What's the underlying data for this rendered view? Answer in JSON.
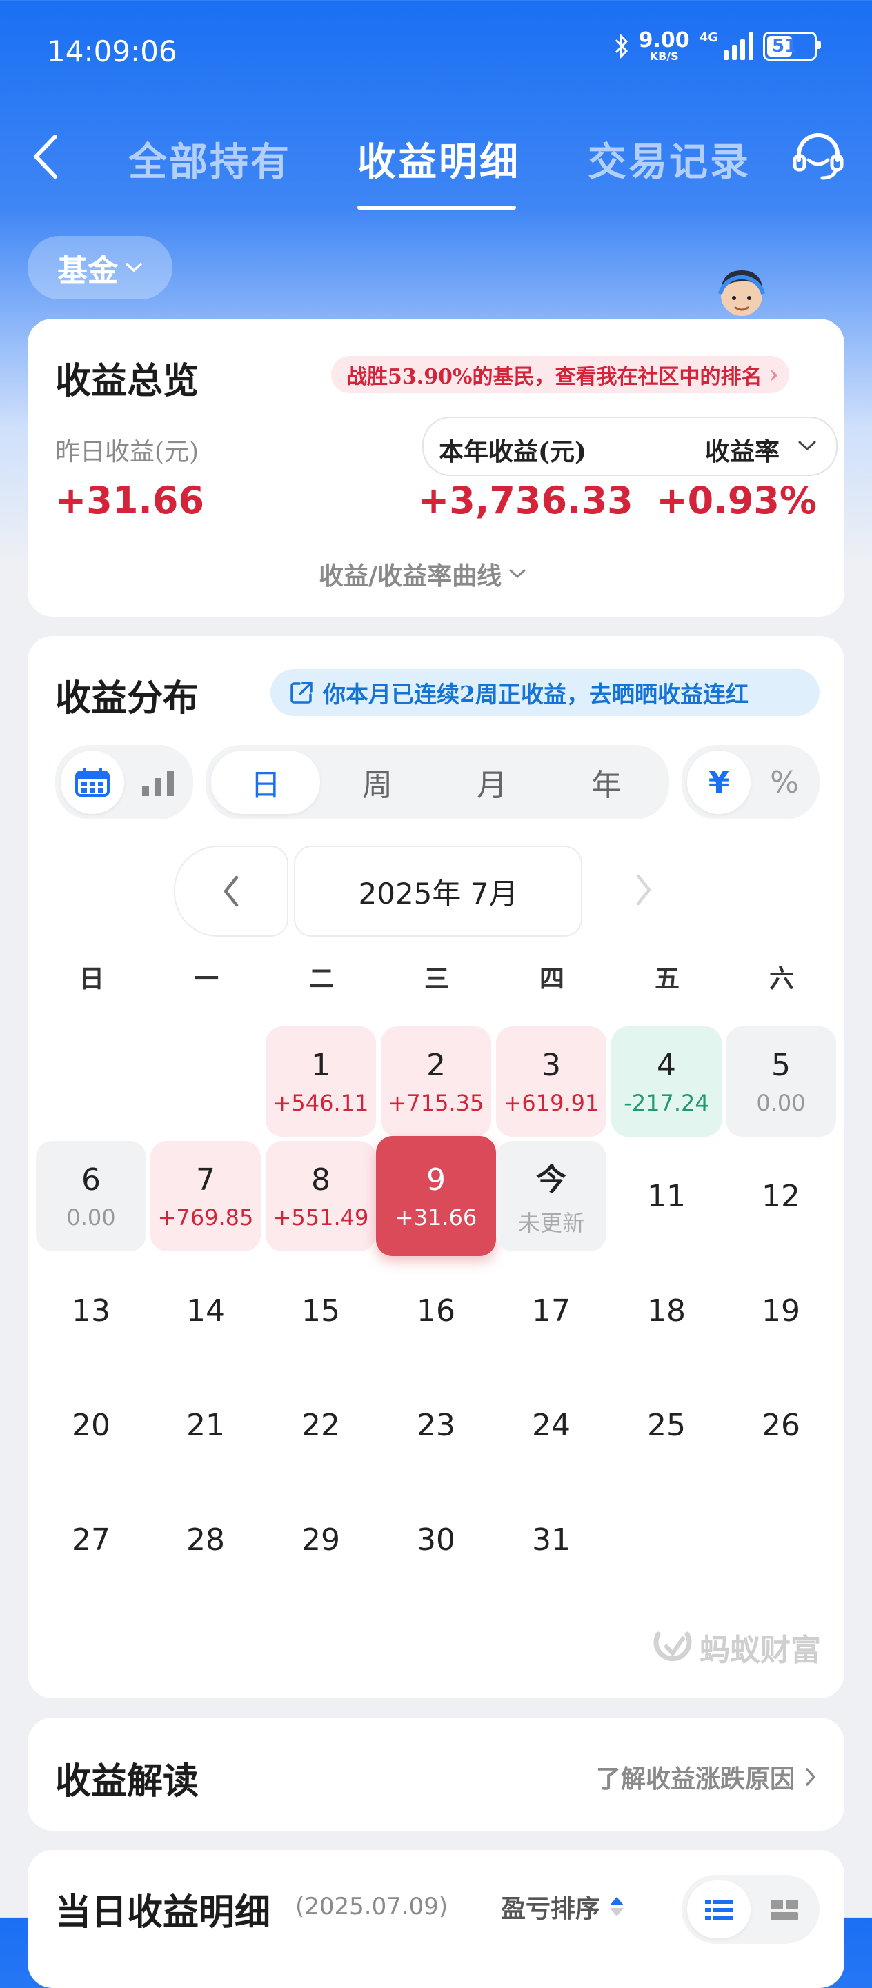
{
  "status_bar": {
    "time": "14:09:06",
    "net_speed": "9.00",
    "net_unit": "KB/S",
    "network_gen": "4G",
    "battery": "51"
  },
  "header": {
    "tabs": [
      {
        "label": "全部持有",
        "active": false
      },
      {
        "label": "收益明细",
        "active": true
      },
      {
        "label": "交易记录",
        "active": false
      }
    ],
    "icons": [
      "chevron-left-icon",
      "headset-icon"
    ]
  },
  "fund_selector": {
    "label": "基金"
  },
  "overview": {
    "title": "收益总览",
    "rank_badge": "战胜53.90%的基民，查看我在社区中的排名",
    "yesterday_label": "昨日收益(元)",
    "yesterday_value": "+31.66",
    "year_label": "本年收益(元)",
    "year_value": "+3,736.33",
    "rate_label": "收益率",
    "rate_value": "+0.93%",
    "curve_link": "收益/收益率曲线"
  },
  "distribution": {
    "title": "收益分布",
    "info_pill": "你本月已连续2周正收益，去晒晒收益连红",
    "period_tabs": [
      "日",
      "周",
      "月",
      "年"
    ],
    "active_period": "日",
    "unit_toggle": [
      "¥",
      "%"
    ],
    "active_unit": "¥",
    "month_label": "2025年 7月",
    "weekdays": [
      "日",
      "一",
      "二",
      "三",
      "四",
      "五",
      "六"
    ],
    "days": [
      {
        "day": "1",
        "value": "+546.11",
        "kind": "pos"
      },
      {
        "day": "2",
        "value": "+715.35",
        "kind": "pos"
      },
      {
        "day": "3",
        "value": "+619.91",
        "kind": "pos"
      },
      {
        "day": "4",
        "value": "-217.24",
        "kind": "neg"
      },
      {
        "day": "5",
        "value": "0.00",
        "kind": "zero"
      },
      {
        "day": "6",
        "value": "0.00",
        "kind": "zero"
      },
      {
        "day": "7",
        "value": "+769.85",
        "kind": "pos"
      },
      {
        "day": "8",
        "value": "+551.49",
        "kind": "pos"
      },
      {
        "day": "9",
        "value": "+31.66",
        "kind": "sel"
      },
      {
        "day": "今",
        "value": "未更新",
        "kind": "today"
      },
      {
        "day": "11",
        "value": "",
        "kind": "plain"
      },
      {
        "day": "12",
        "value": "",
        "kind": "plain"
      },
      {
        "day": "13",
        "value": "",
        "kind": "plain"
      },
      {
        "day": "14",
        "value": "",
        "kind": "plain"
      },
      {
        "day": "15",
        "value": "",
        "kind": "plain"
      },
      {
        "day": "16",
        "value": "",
        "kind": "plain"
      },
      {
        "day": "17",
        "value": "",
        "kind": "plain"
      },
      {
        "day": "18",
        "value": "",
        "kind": "plain"
      },
      {
        "day": "19",
        "value": "",
        "kind": "plain"
      },
      {
        "day": "20",
        "value": "",
        "kind": "plain"
      },
      {
        "day": "21",
        "value": "",
        "kind": "plain"
      },
      {
        "day": "22",
        "value": "",
        "kind": "plain"
      },
      {
        "day": "23",
        "value": "",
        "kind": "plain"
      },
      {
        "day": "24",
        "value": "",
        "kind": "plain"
      },
      {
        "day": "25",
        "value": "",
        "kind": "plain"
      },
      {
        "day": "26",
        "value": "",
        "kind": "plain"
      },
      {
        "day": "27",
        "value": "",
        "kind": "plain"
      },
      {
        "day": "28",
        "value": "",
        "kind": "plain"
      },
      {
        "day": "29",
        "value": "",
        "kind": "plain"
      },
      {
        "day": "30",
        "value": "",
        "kind": "plain"
      },
      {
        "day": "31",
        "value": "",
        "kind": "plain"
      }
    ],
    "watermark": "蚂蚁财富"
  },
  "interpretation": {
    "title": "收益解读",
    "link": "了解收益涨跌原因"
  },
  "daily_detail": {
    "title": "当日收益明细",
    "date": "(2025.07.09)",
    "sort_label": "盈亏排序"
  },
  "colors": {
    "brand_blue": "#1a6ff3",
    "positive_red": "#d3243a",
    "negative_green": "#1e9a6e",
    "selected_red": "#db4a58"
  }
}
